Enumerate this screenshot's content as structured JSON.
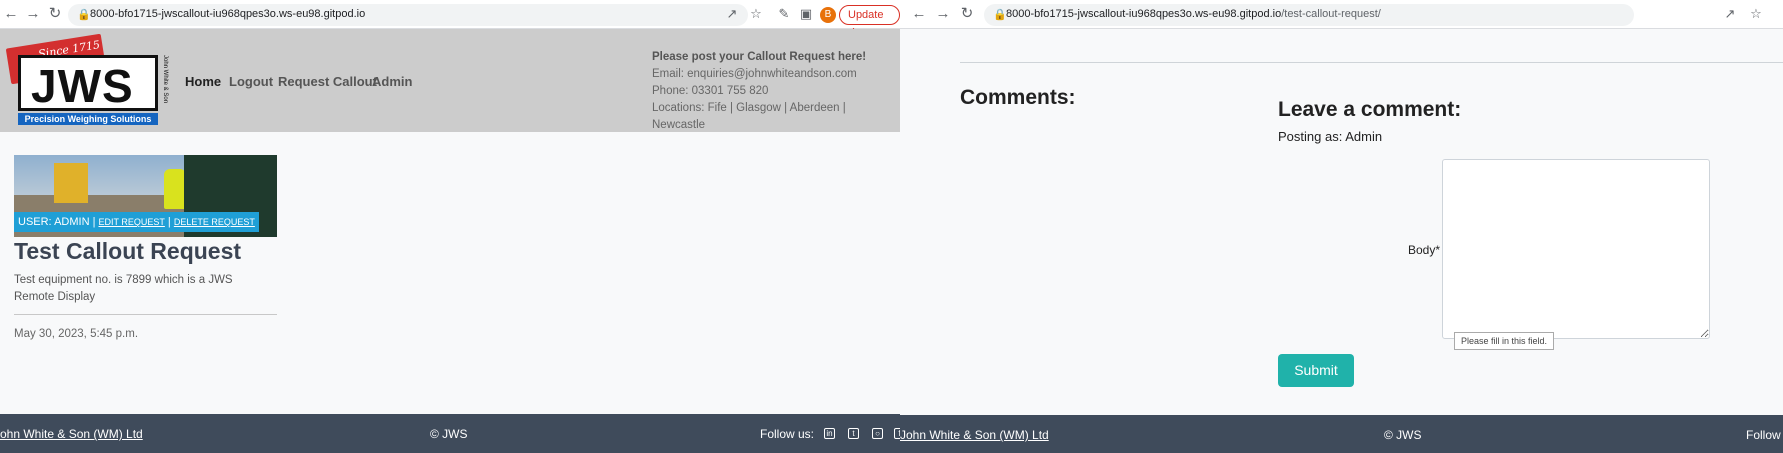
{
  "left_window": {
    "url": "8000-bfo1715-jwscallout-iu968qpes3o.ws-eu98.gitpod.io",
    "profile_initial": "B",
    "update_label": "Update",
    "logo": {
      "since": "Since 1715",
      "wordmark": "JWS",
      "side_text": "John White & Son",
      "tagline": "Precision Weighing Solutions"
    },
    "nav": [
      {
        "label": "Home",
        "active": true
      },
      {
        "label": "Logout"
      },
      {
        "label": "Request Callout"
      },
      {
        "label": "Admin"
      }
    ],
    "contact": {
      "headline": "Please post your Callout Request here!",
      "email": "Email: enquiries@johnwhiteandson.com",
      "phone": "Phone: 03301 755 820",
      "locations": "Locations: Fife | Glasgow | Aberdeen | Newcastle"
    },
    "post": {
      "user_label": "USER: ADMIN |",
      "edit_label": "EDIT REQUEST",
      "separator": "|",
      "delete_label": "DELETE REQUEST",
      "title": "Test Callout Request",
      "excerpt": "Test equipment no. is 7899 which is a JWS Remote Display",
      "date": "May 30, 2023, 5:45 p.m."
    },
    "footer": {
      "owner": "John White & Son (WM) Ltd",
      "copyright": "© JWS",
      "follow": "Follow us:"
    }
  },
  "right_window": {
    "url_host": "8000-bfo1715-jwscallout-iu968qpes3o.ws-eu98.gitpod.io",
    "url_path": "/test-callout-request/",
    "comments_heading": "Comments:",
    "leave_heading": "Leave a comment:",
    "posting_as": "Posting as: Admin",
    "body_label": "Body*",
    "validation_tooltip": "Please fill in this field.",
    "submit_label": "Submit",
    "footer": {
      "owner": "John White & Son (WM) Ltd",
      "copyright": "© JWS",
      "follow": "Follow"
    }
  }
}
